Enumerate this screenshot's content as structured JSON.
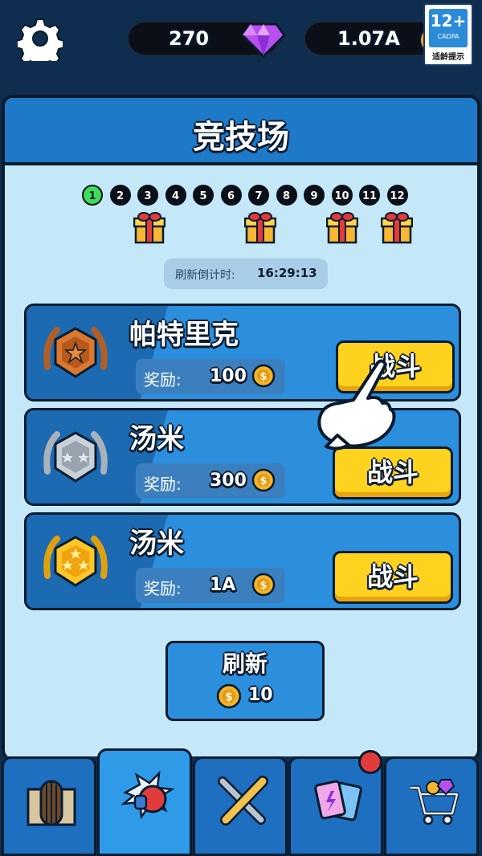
{
  "topbar": {
    "gems": "270",
    "money": "1.07A",
    "age_rating": {
      "num": "12+",
      "org": "CADPA",
      "label": "适龄提示"
    }
  },
  "panel": {
    "title": "竞技场",
    "progress": {
      "steps": [
        "1",
        "2",
        "3",
        "4",
        "5",
        "6",
        "7",
        "8",
        "9",
        "10",
        "11",
        "12"
      ],
      "current": 1
    },
    "countdown_label": "刷新倒计时:",
    "countdown_time": "16:29:13",
    "opponents": [
      {
        "name": "帕特里克",
        "reward_label": "奖励:",
        "reward": "100",
        "button": "战斗",
        "rank": "bronze"
      },
      {
        "name": "汤米",
        "reward_label": "奖励:",
        "reward": "300",
        "button": "战斗",
        "rank": "silver"
      },
      {
        "name": "汤米",
        "reward_label": "奖励:",
        "reward": "1A",
        "button": "战斗",
        "rank": "gold"
      }
    ],
    "refresh": {
      "label": "刷新",
      "cost": "10"
    }
  },
  "colors": {
    "accent": "#ffd21f",
    "panel": "#c4e8f7",
    "header": "#1e79c8",
    "active_step": "#3ddc5a"
  },
  "nav": {
    "items": [
      "castle-icon",
      "boxing-glove-icon",
      "weapons-icon",
      "cards-icon",
      "shop-cart-icon"
    ],
    "active": 1
  }
}
